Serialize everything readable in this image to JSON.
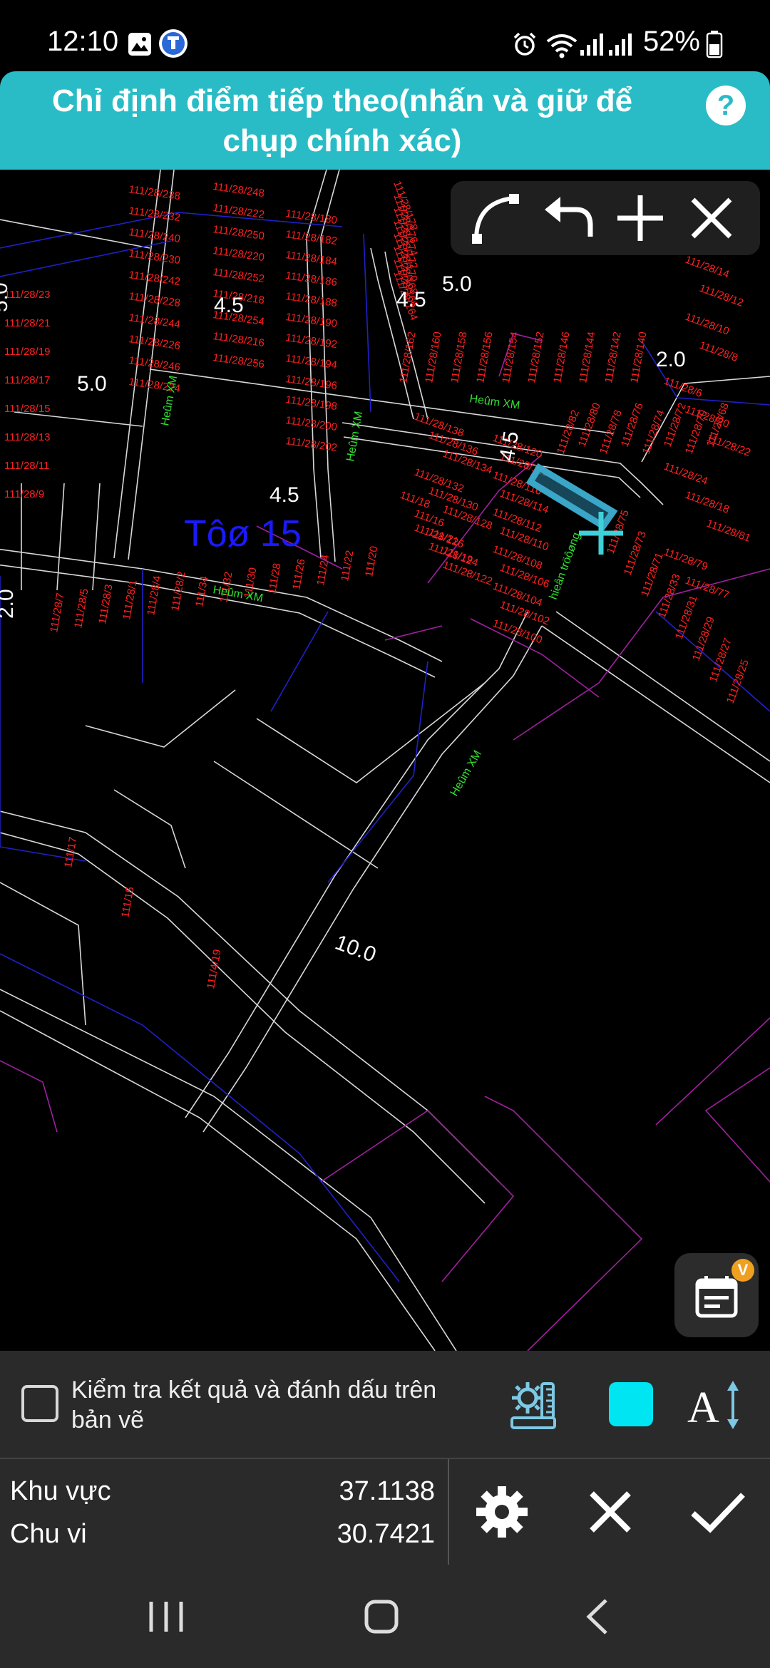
{
  "status_bar": {
    "time": "12:10",
    "battery": "52%",
    "icons": [
      "gallery-icon",
      "app-icon",
      "alarm-icon",
      "wifi-icon",
      "signal-icon",
      "battery-icon"
    ]
  },
  "header": {
    "instruction": "Chỉ định điểm tiếp theo(nhấn và giữ để chụp chính xác)",
    "help_label": "?"
  },
  "toolbar": {
    "buttons": [
      "arc-icon",
      "undo-icon",
      "add-icon",
      "close-icon"
    ]
  },
  "drawing": {
    "block_label": "Tôø 15",
    "road_widths": [
      "5.0",
      "4.5",
      "4.5",
      "2.0",
      "5.0",
      "4.5",
      "4.5",
      "5.0",
      "2.0",
      "10.0"
    ],
    "alley_labels": [
      "Heûm XM",
      "Heûm XM",
      "Heûm XM",
      "Heûm XM",
      "Heûm XM",
      "hieân tröôøng"
    ],
    "parcels": [
      "111/28/238",
      "111/28/232",
      "111/28/240",
      "111/28/230",
      "111/28/242",
      "111/28/228",
      "111/28/244",
      "111/28/226",
      "111/28/246",
      "111/28/224",
      "111/28/248",
      "111/28/222",
      "111/28/250",
      "111/28/220",
      "111/28/252",
      "111/28/218",
      "111/28/254",
      "111/28/216",
      "111/28/256",
      "111/28/180",
      "111/28/182",
      "111/28/184",
      "111/28/186",
      "111/28/188",
      "111/28/190",
      "111/28/192",
      "111/28/194",
      "111/28/196",
      "111/28/198",
      "111/28/200",
      "111/28/202",
      "111/28/178",
      "111/28/176",
      "111/28/174",
      "111/28/172",
      "111/28/170",
      "111/28/168",
      "111/28/166",
      "111/28/164",
      "111/28/162",
      "111/28/160",
      "111/28/158",
      "111/28/156",
      "111/28/154",
      "111/28/152",
      "111/28/146",
      "111/28/144",
      "111/28/142",
      "111/28/140",
      "111/28/138",
      "111/28/136",
      "111/28/134",
      "111/28/132",
      "111/28/130",
      "111/28/128",
      "111/28/126",
      "111/28/124",
      "111/28/122",
      "111/28/120",
      "111/28/118",
      "111/28/116",
      "111/28/114",
      "111/28/112",
      "111/28/110",
      "111/28/108",
      "111/28/106",
      "111/28/104",
      "111/28/102",
      "111/28/100",
      "111/28/82",
      "111/28/80",
      "111/28/78",
      "111/28/76",
      "111/28/74",
      "111/28/72",
      "111/28/70",
      "111/28/68",
      "111/28/66",
      "111/28/16",
      "111/28/14",
      "111/28/12",
      "111/28/10",
      "111/28/8",
      "111/28/6",
      "111/28/20",
      "111/28/22",
      "111/28/24",
      "111/28/18",
      "111/28/81",
      "111/28/79",
      "111/28/77",
      "111/28/75",
      "111/28/73",
      "111/28/71",
      "111/28/33",
      "111/28/31",
      "111/28/29",
      "111/28/27",
      "111/28/25",
      "111/28/23",
      "111/28/21",
      "111/28/19",
      "111/28/17",
      "111/28/15",
      "111/28/13",
      "111/28/11",
      "111/28/9",
      "111/28/7",
      "111/28/5",
      "111/28/3",
      "111/28/1",
      "111/28/4",
      "111/28/2",
      "111/34",
      "111/32",
      "111/30",
      "111/28",
      "111/26",
      "111/24",
      "111/22",
      "111/20",
      "111/18",
      "111/16",
      "111/21",
      "111/19",
      "111/17",
      "111/15",
      "111/4/19"
    ]
  },
  "options": {
    "mark_label": "Kiểm tra kết quả và đánh dấu trên bản vẽ",
    "mark_checked": false,
    "color": "#00e5f2"
  },
  "results": {
    "area_label": "Khu vực",
    "area_value": "37.1138",
    "perimeter_label": "Chu vi",
    "perimeter_value": "30.7421"
  },
  "colors": {
    "accent": "#29bcc6",
    "parcel_label": "#ff2020",
    "selection": "#3aa6c8",
    "block_label": "#1a1aff"
  }
}
